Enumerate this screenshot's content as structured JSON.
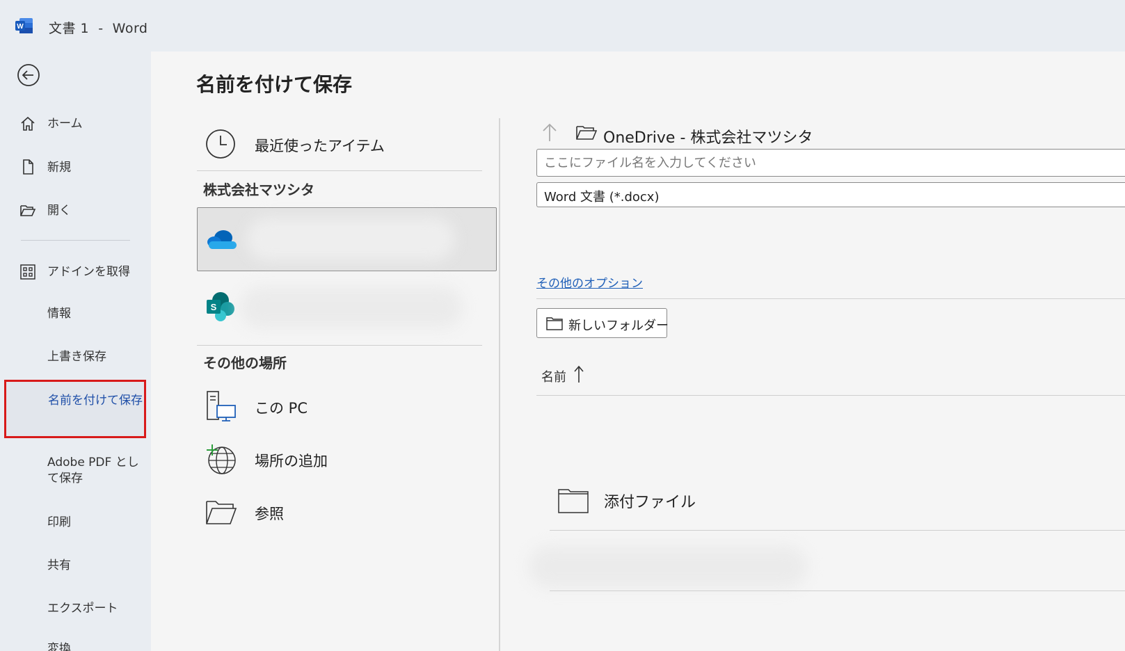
{
  "window": {
    "title": "文書 1  -  Word"
  },
  "sidebar": {
    "items": [
      {
        "label": "ホーム"
      },
      {
        "label": "新規"
      },
      {
        "label": "開く"
      },
      {
        "label": "アドインを取得"
      },
      {
        "label": "情報"
      },
      {
        "label": "上書き保存"
      },
      {
        "label": "名前を付けて保存",
        "selected": true
      },
      {
        "label": "Adobe PDF として保存"
      },
      {
        "label": "印刷"
      },
      {
        "label": "共有"
      },
      {
        "label": "エクスポート"
      },
      {
        "label": "変換"
      }
    ]
  },
  "main": {
    "title": "名前を付けて保存",
    "locations": {
      "recent": "最近使ったアイテム",
      "org_section": "株式会社マツシタ",
      "other_section": "その他の場所",
      "this_pc": "この PC",
      "add_place": "場所の追加",
      "browse": "参照"
    },
    "save": {
      "path": "OneDrive - 株式会社マツシタ",
      "filename_placeholder": "ここにファイル名を入力してください",
      "filetype": "Word 文書 (*.docx)",
      "more_options": "その他のオプション",
      "new_folder": "新しいフォルダー",
      "column_name": "名前",
      "files": [
        {
          "name": "添付ファイル"
        }
      ]
    }
  },
  "colors": {
    "accent_blue": "#1f5fb8",
    "highlight_red": "#d81a1a",
    "word_blue": "#185abd"
  }
}
